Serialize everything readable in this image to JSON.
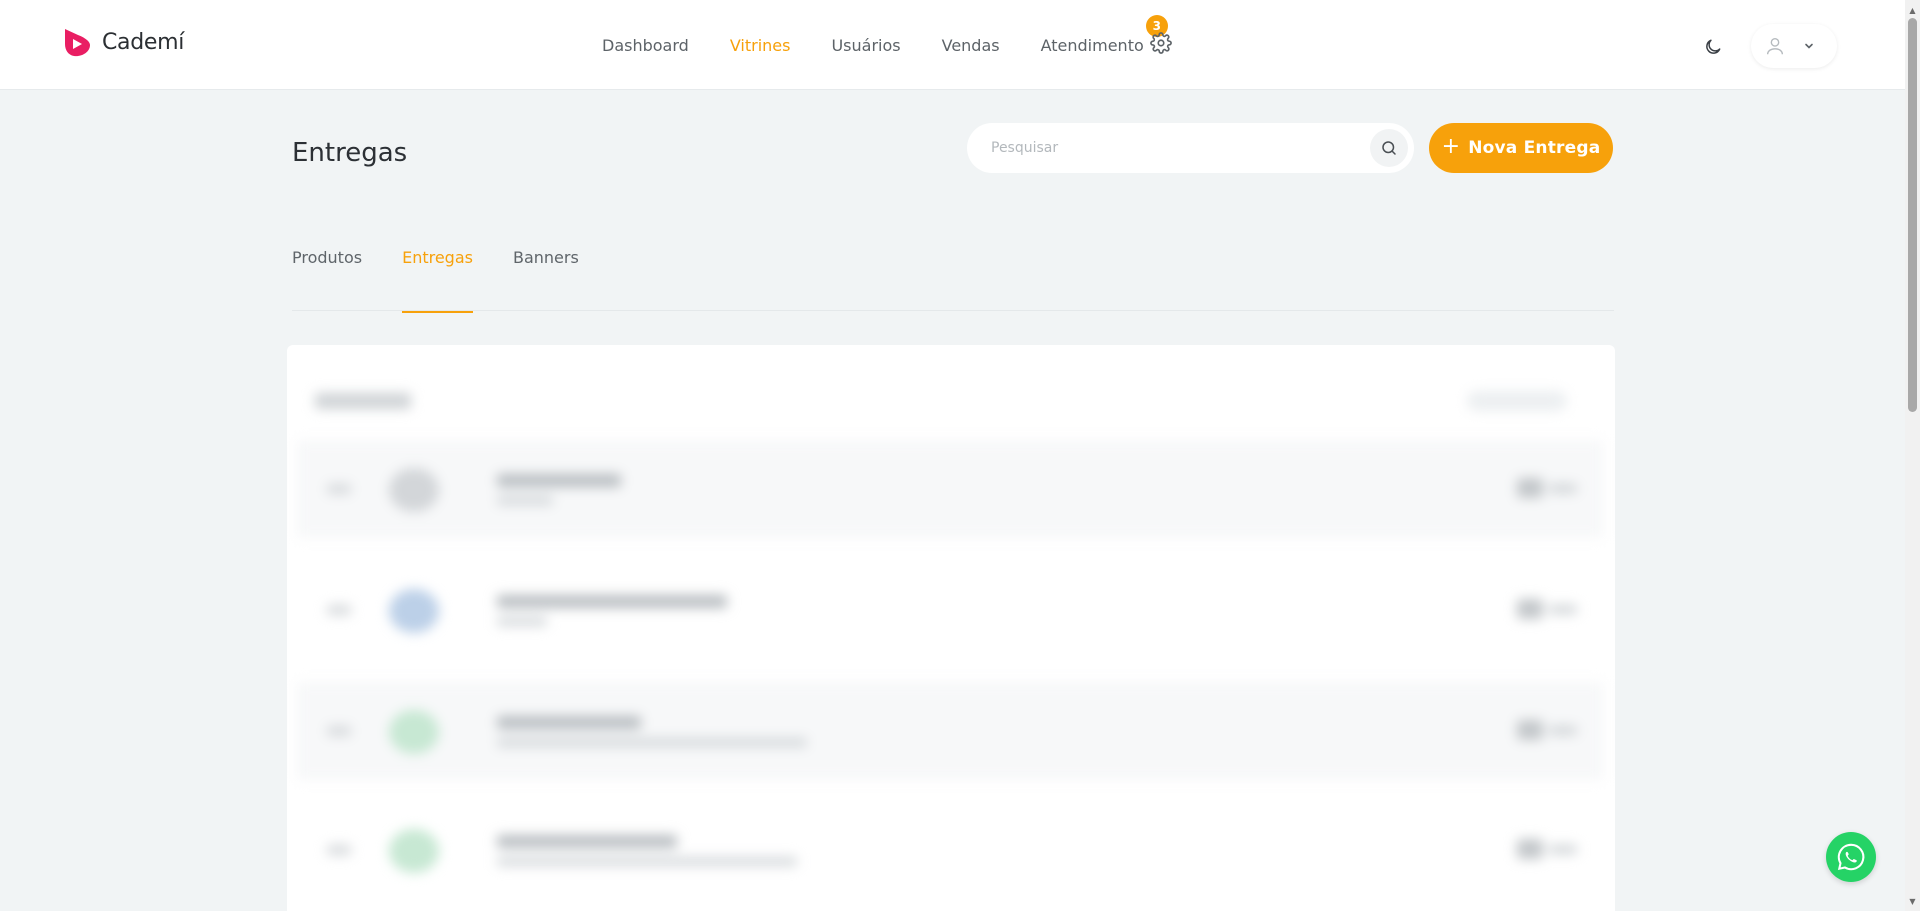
{
  "brand": {
    "name": "Cademí",
    "color": "#e91e63"
  },
  "nav": {
    "items": [
      {
        "label": "Dashboard",
        "active": false
      },
      {
        "label": "Vitrines",
        "active": true
      },
      {
        "label": "Usuários",
        "active": false
      },
      {
        "label": "Vendas",
        "active": false
      },
      {
        "label": "Atendimento",
        "active": false,
        "badge": "3"
      }
    ],
    "icons": [
      "gear-icon",
      "moon-icon",
      "user-icon",
      "chevron-down-icon"
    ]
  },
  "page": {
    "title": "Entregas"
  },
  "search": {
    "placeholder": "Pesquisar",
    "value": ""
  },
  "actions": {
    "new_label": "Nova Entrega",
    "accent": "#f7a10b"
  },
  "tabs": [
    {
      "label": "Produtos",
      "active": false
    },
    {
      "label": "Entregas",
      "active": true
    },
    {
      "label": "Banners",
      "active": false
    }
  ],
  "floating": {
    "icon": "whatsapp-icon",
    "color": "#25d366"
  }
}
